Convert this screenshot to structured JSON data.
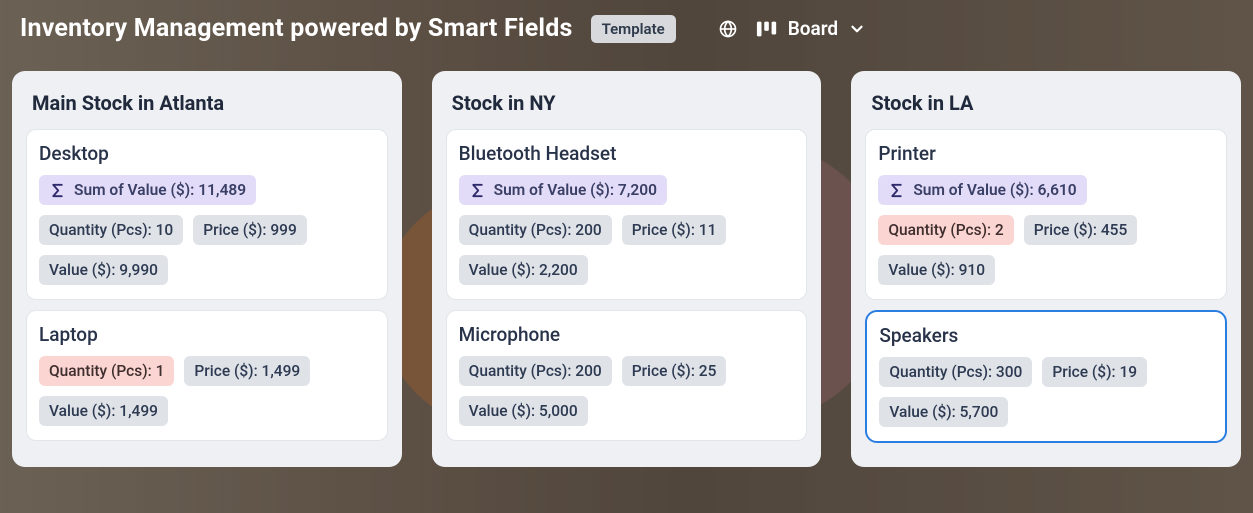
{
  "header": {
    "title": "Inventory Management powered by Smart Fields",
    "template_badge": "Template",
    "view_label": "Board"
  },
  "labels": {
    "sum_prefix": "Sum of Value ($): ",
    "qty_prefix": "Quantity (Pcs): ",
    "price_prefix": "Price ($): ",
    "value_prefix": "Value ($): "
  },
  "columns": [
    {
      "title": "Main Stock in Atlanta",
      "cards": [
        {
          "title": "Desktop",
          "sum": "11,489",
          "qty": "10",
          "qty_warn": false,
          "price": "999",
          "value": "9,990",
          "selected": false
        },
        {
          "title": "Laptop",
          "sum": null,
          "qty": "1",
          "qty_warn": true,
          "price": "1,499",
          "value": "1,499",
          "selected": false
        }
      ]
    },
    {
      "title": "Stock in NY",
      "cards": [
        {
          "title": "Bluetooth Headset",
          "sum": "7,200",
          "qty": "200",
          "qty_warn": false,
          "price": "11",
          "value": "2,200",
          "selected": false
        },
        {
          "title": "Microphone",
          "sum": null,
          "qty": "200",
          "qty_warn": false,
          "price": "25",
          "value": "5,000",
          "selected": false
        }
      ]
    },
    {
      "title": "Stock in LA",
      "cards": [
        {
          "title": "Printer",
          "sum": "6,610",
          "qty": "2",
          "qty_warn": true,
          "price": "455",
          "value": "910",
          "selected": false
        },
        {
          "title": "Speakers",
          "sum": null,
          "qty": "300",
          "qty_warn": false,
          "price": "19",
          "value": "5,700",
          "selected": true
        }
      ]
    }
  ]
}
